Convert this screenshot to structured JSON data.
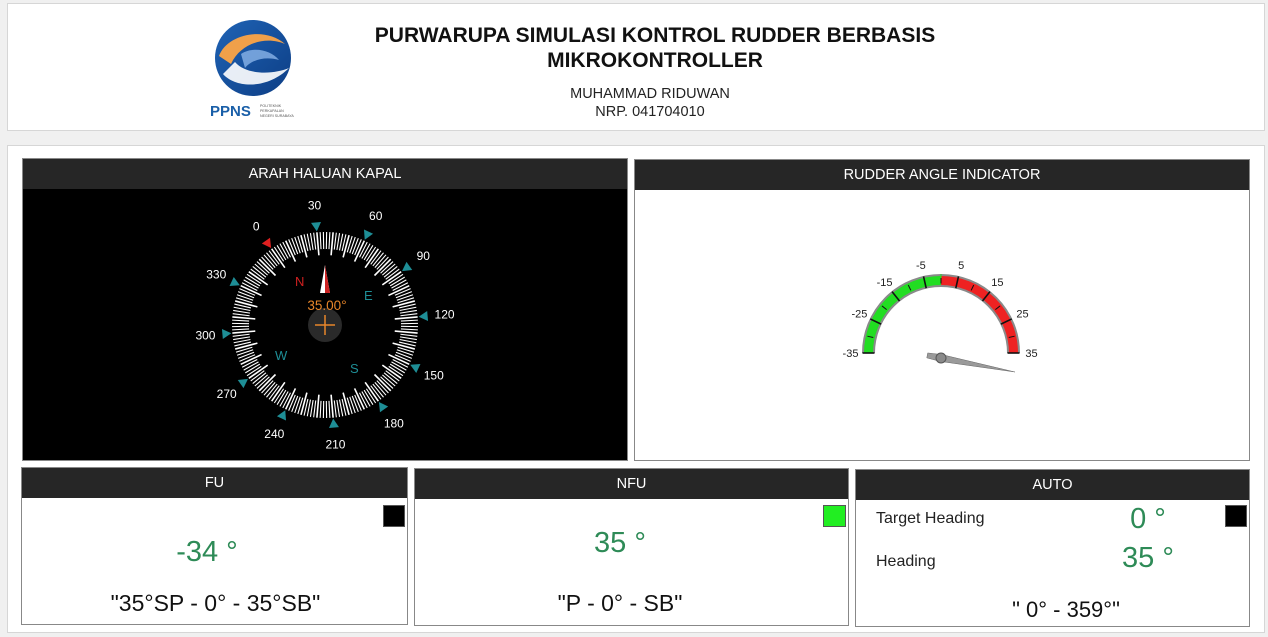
{
  "header": {
    "logo_text": "PPNS",
    "logo_subtext": [
      "POLITEKNIK",
      "PERKAPALAN",
      "NEGERI SURABAYA"
    ],
    "title_line1": "PURWARUPA SIMULASI KONTROL RUDDER BERBASIS",
    "title_line2": "MIKROKONTROLLER",
    "author_name": "MUHAMMAD RIDUWAN",
    "author_nrp": "NRP. 041704010"
  },
  "compass": {
    "title": "ARAH HALUAN KAPAL",
    "heading_readout": "35.00°",
    "heading_value": 35,
    "degree_labels": [
      "0",
      "30",
      "60",
      "90",
      "120",
      "150",
      "180",
      "210",
      "240",
      "270",
      "300",
      "330"
    ],
    "cardinals": [
      "N",
      "E",
      "S",
      "W"
    ],
    "colors": {
      "background": "#000000",
      "marker": "#1e8e96",
      "north_marker": "#e02020",
      "readout": "#e8862a",
      "cardinal_n": "#d02020"
    }
  },
  "rudder": {
    "title": "RUDDER ANGLE INDICATOR",
    "scale_labels": [
      "-35",
      "-25",
      "-15",
      "-5",
      "5",
      "15",
      "25",
      "35"
    ],
    "range_min": -35,
    "range_max": 35,
    "needle_value": 35,
    "colors": {
      "port": "#22dd22",
      "starboard": "#ee2222",
      "bezel": "#8a8a8a"
    }
  },
  "fu": {
    "title": "FU",
    "value": "-34 °",
    "range_text": "\"35°SP - 0° - 35°SB\"",
    "indicator_color": "#000000"
  },
  "nfu": {
    "title": "NFU",
    "value": "35 °",
    "range_text": "\"P - 0° - SB\"",
    "indicator_color": "#22ee22"
  },
  "auto": {
    "title": "AUTO",
    "target_label": "Target Heading",
    "target_value": "0 °",
    "heading_label": "Heading",
    "heading_value": "35 °",
    "range_text": "\" 0° - 359°\"",
    "indicator_color": "#000000"
  }
}
